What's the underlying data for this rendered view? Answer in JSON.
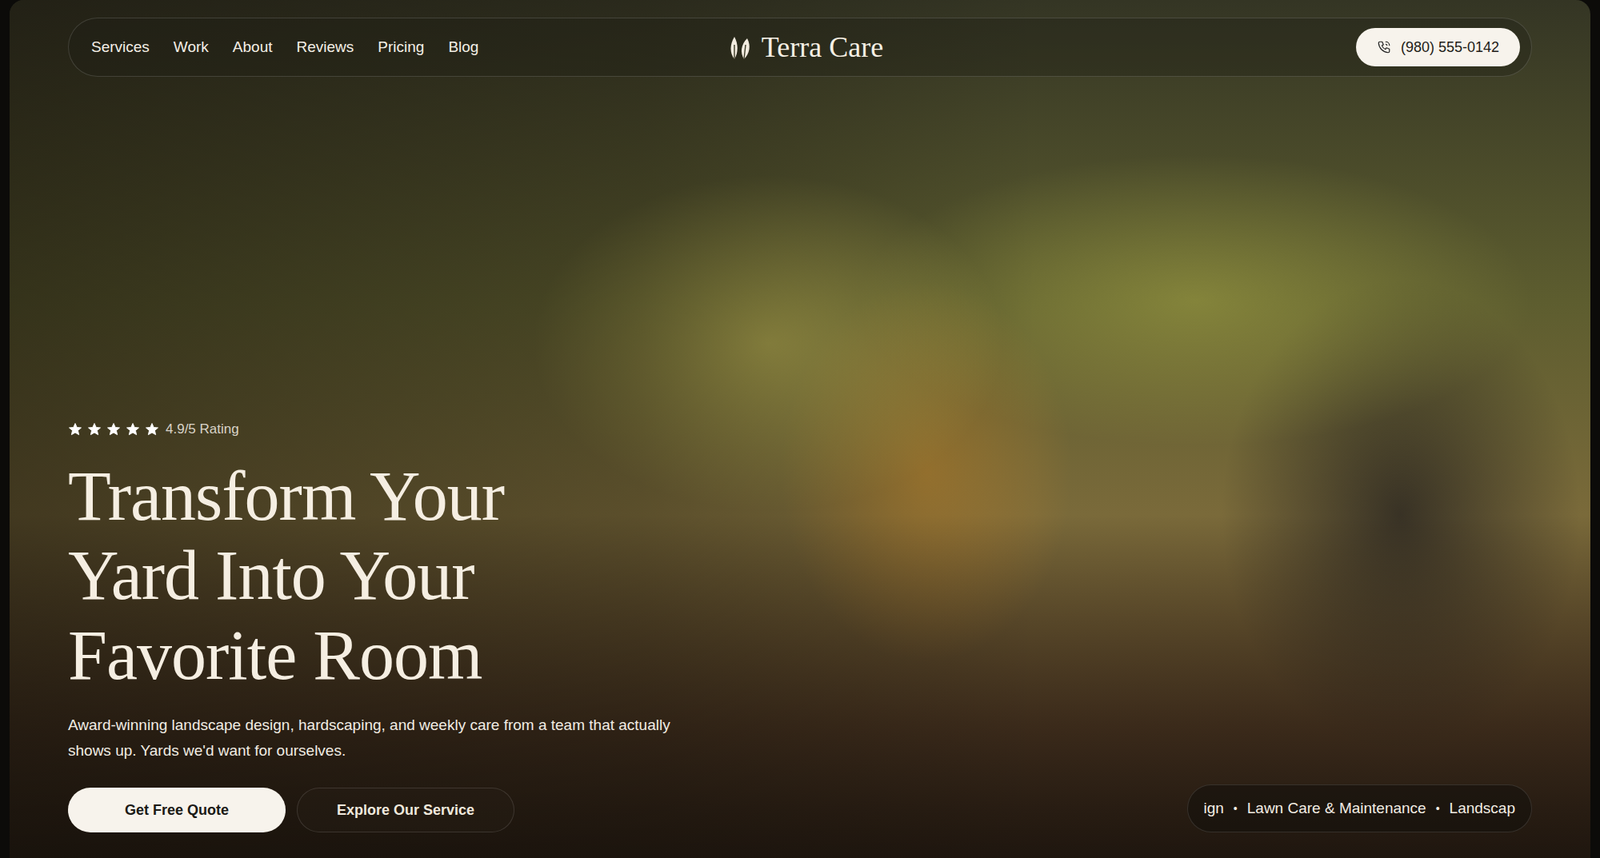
{
  "nav": {
    "links": [
      "Services",
      "Work",
      "About",
      "Reviews",
      "Pricing",
      "Blog"
    ],
    "brand": "Terra Care",
    "phone": "(980) 555-0142"
  },
  "hero": {
    "rating": {
      "stars": 5,
      "label": "4.9/5 Rating"
    },
    "headline": [
      "Transform Your",
      "Yard Into Your",
      "Favorite Room"
    ],
    "subtitle": "Award-winning landscape design, hardscaping, and weekly care from a team that actually shows up. Yards we'd want for ourselves.",
    "buttons": [
      {
        "label": "Get Free Quote",
        "kind": "primary"
      },
      {
        "label": "Explore Our Service",
        "kind": "secondary"
      }
    ]
  },
  "ticker": {
    "separator": "•",
    "items": [
      "ign",
      "Lawn Care & Maintenance",
      "Landscap"
    ]
  }
}
